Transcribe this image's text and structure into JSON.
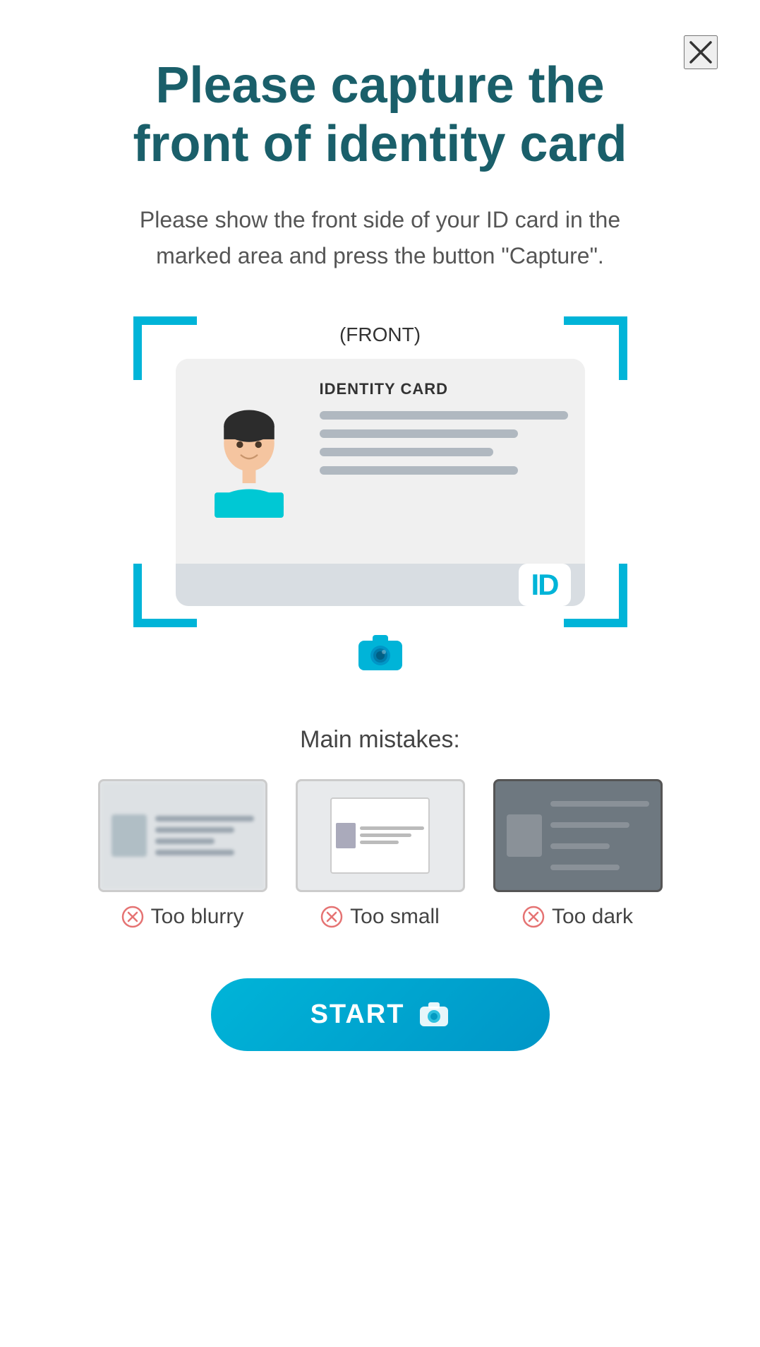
{
  "page": {
    "title_line1": "Please capture the",
    "title_line2": "front of identity card",
    "subtitle": "Please show the front side of your ID card in the marked area and press the button \"Capture\".",
    "front_label": "(FRONT)",
    "id_card_title": "IDENTITY CARD",
    "camera_aria": "camera capture area",
    "mistakes_title": "Main mistakes:",
    "mistakes": [
      {
        "id": "blurry",
        "label": "Too blurry",
        "style": "blurry"
      },
      {
        "id": "small",
        "label": "Too small",
        "style": "small"
      },
      {
        "id": "dark",
        "label": "Too dark",
        "style": "dark"
      }
    ],
    "start_button": "START",
    "close_label": "Close"
  },
  "colors": {
    "teal": "#1a5f6a",
    "blue": "#00b4d8",
    "error_red": "#e57373"
  }
}
